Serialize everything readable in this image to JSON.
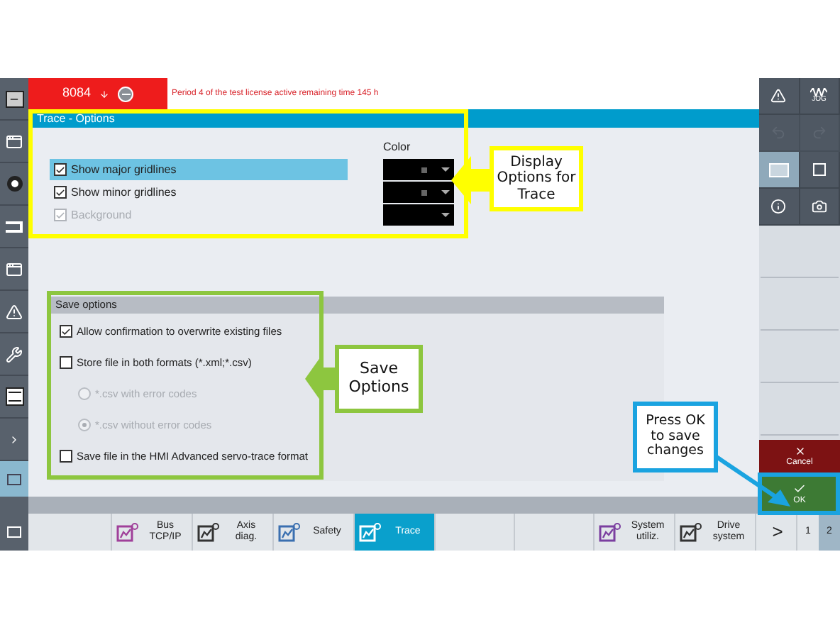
{
  "header": {
    "channel": "8084",
    "message": "Period 4 of the test license active remaining time 145 h"
  },
  "title": "Trace - Options",
  "display_options": {
    "color_heading": "Color",
    "rows": [
      {
        "label": "Show major gridlines",
        "checked": true,
        "disabled": false,
        "selected": true,
        "swatch": true
      },
      {
        "label": "Show minor gridlines",
        "checked": true,
        "disabled": false,
        "selected": false,
        "swatch": true
      },
      {
        "label": "Background",
        "checked": true,
        "disabled": true,
        "selected": false,
        "swatch": false
      }
    ]
  },
  "save_options": {
    "title": "Save options",
    "items": [
      {
        "kind": "checkbox",
        "label": "Allow confirmation to overwrite existing files",
        "checked": true,
        "disabled": false
      },
      {
        "kind": "checkbox",
        "label": "Store file in both formats (*.xml;*.csv)",
        "checked": false,
        "disabled": false,
        "children": [
          {
            "kind": "radio",
            "label": "*.csv with error codes",
            "selected": false,
            "disabled": true
          },
          {
            "kind": "radio",
            "label": "*.csv without error codes",
            "selected": true,
            "disabled": true
          }
        ]
      },
      {
        "kind": "checkbox",
        "label": "Save file in the HMI Advanced servo-trace format",
        "checked": false,
        "disabled": false
      }
    ]
  },
  "right_panel": {
    "buttons": [
      {
        "kind": "alarm",
        "selected": false,
        "disabled": false
      },
      {
        "kind": "jog",
        "label": "JOG",
        "selected": false,
        "disabled": false
      },
      {
        "kind": "undo",
        "selected": false,
        "disabled": true
      },
      {
        "kind": "redo",
        "selected": false,
        "disabled": true
      },
      {
        "kind": "window",
        "selected": true,
        "disabled": false
      },
      {
        "kind": "small-window",
        "selected": false,
        "disabled": false
      },
      {
        "kind": "info",
        "selected": false,
        "disabled": false
      },
      {
        "kind": "camera",
        "selected": false,
        "disabled": false
      }
    ],
    "cancel": "Cancel",
    "ok": "OK"
  },
  "softkeys": [
    {
      "kind": "blank"
    },
    {
      "kind": "bus",
      "label": "Bus\nTCP/IP",
      "selected": false
    },
    {
      "kind": "axis",
      "label": "Axis\ndiag.",
      "selected": false
    },
    {
      "kind": "safety",
      "label": "Safety",
      "selected": false
    },
    {
      "kind": "trace",
      "label": "Trace",
      "selected": true
    },
    {
      "kind": "blank"
    },
    {
      "kind": "blank"
    },
    {
      "kind": "system",
      "label": "System\nutiliz.",
      "selected": false
    },
    {
      "kind": "drive",
      "label": "Drive\nsystem",
      "selected": false
    }
  ],
  "page_nav": {
    "next": ">",
    "pages": [
      {
        "label": "1",
        "selected": false
      },
      {
        "label": "2",
        "selected": true
      }
    ]
  },
  "annotations": [
    {
      "kind": "display",
      "text": "Display Options for Trace",
      "color": "#ffff00"
    },
    {
      "kind": "save",
      "text": "Save Options",
      "color": "#8dc63f"
    },
    {
      "kind": "ok",
      "text": "Press OK to save changes",
      "color": "#1aa3e0"
    }
  ]
}
